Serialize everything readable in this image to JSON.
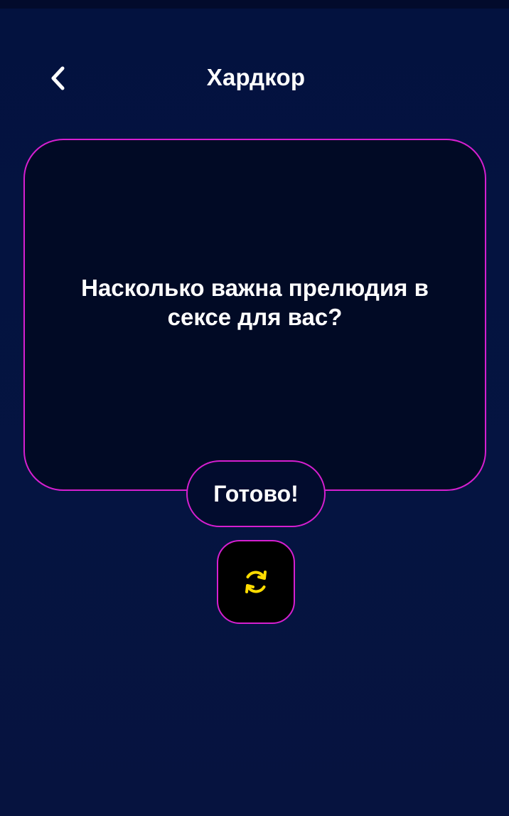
{
  "header": {
    "title": "Хардкор",
    "back_icon": "chevron-left-icon"
  },
  "card": {
    "question": "Насколько важна прелюдия в сексе для вас?"
  },
  "actions": {
    "done_label": "Готово!",
    "refresh_icon": "refresh-icon"
  },
  "colors": {
    "background": "#05133f",
    "card_background": "#010a25",
    "accent_border": "#d61fd0",
    "refresh_icon": "#ffdc00",
    "text": "#ffffff"
  }
}
